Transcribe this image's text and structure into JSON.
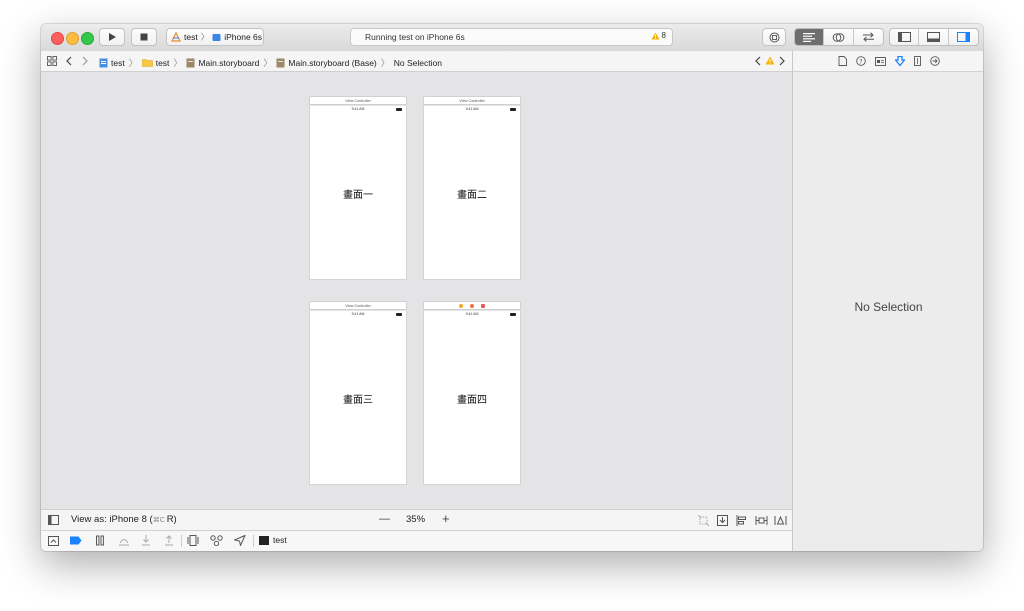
{
  "toolbar": {
    "scheme_target": "test",
    "scheme_device": "iPhone 6s",
    "activity_text": "Running test on iPhone 6s",
    "warning_count": "8",
    "colors": {
      "close": "#fc605b",
      "minimize": "#fdbc40",
      "zoom": "#34c84a",
      "accent": "#1a82fb"
    }
  },
  "jumpbar": {
    "crumbs": [
      "test",
      "test",
      "Main.storyboard",
      "Main.storyboard (Base)",
      "No Selection"
    ]
  },
  "scenes": [
    {
      "header": "View Controller",
      "time": "9:41 AM",
      "label": "畫面一"
    },
    {
      "header": "View Controller",
      "time": "9:41 AM",
      "label": "畫面二"
    },
    {
      "header": "View Controller",
      "time": "9:41 AM",
      "label": "畫面三"
    },
    {
      "header": "",
      "time": "9:41 AM",
      "label": "畫面四"
    }
  ],
  "canvas_bar": {
    "view_as": "View as: iPhone 8 (",
    "view_as_shortcut": "⌘C ",
    "view_as_suffix": "R)",
    "zoom": "35%",
    "zoom_out": "—",
    "zoom_in": "+"
  },
  "debug_bar": {
    "target": "test"
  },
  "inspector": {
    "empty_text": "No Selection"
  }
}
